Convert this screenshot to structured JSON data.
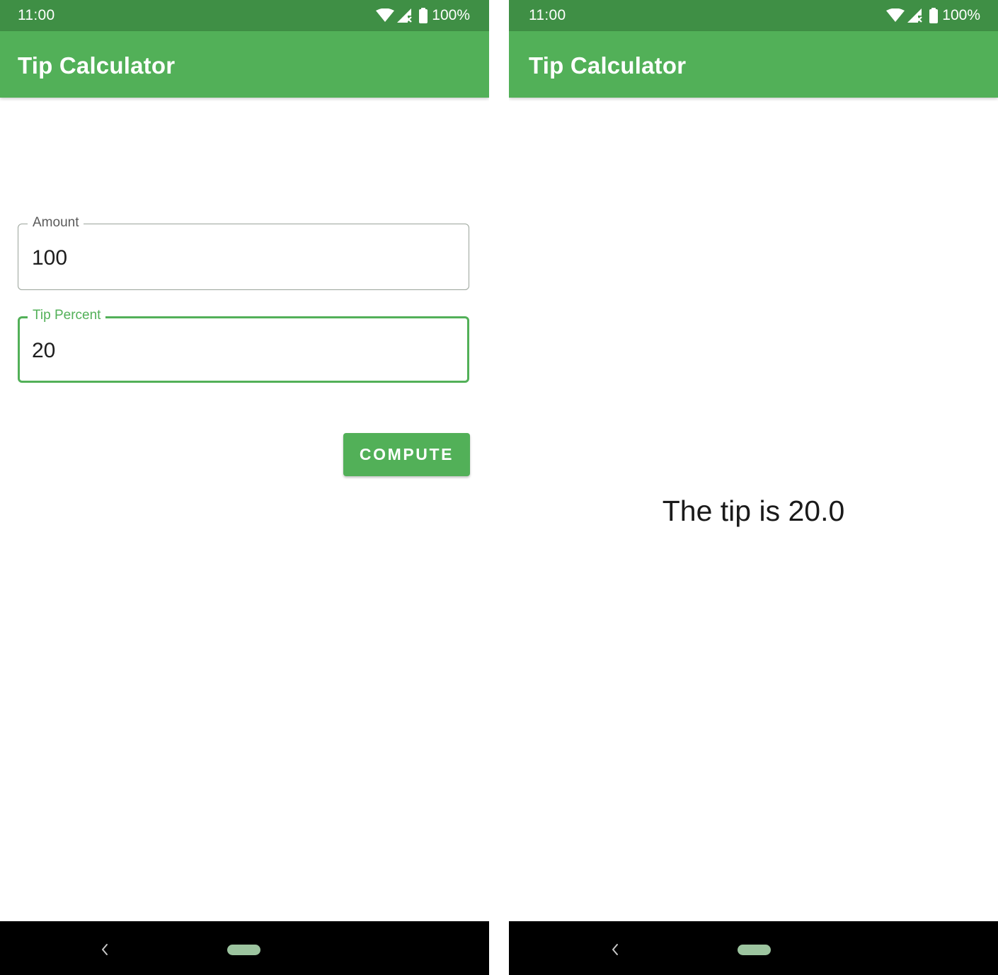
{
  "colors": {
    "status_bar": "#3f8f45",
    "app_bar": "#52b058",
    "accent": "#52b058",
    "nav_bar": "#000000"
  },
  "left_screen": {
    "status": {
      "time": "11:00",
      "battery": "100%",
      "icons": [
        "wifi-icon",
        "signal-icon",
        "battery-icon"
      ]
    },
    "app_bar": {
      "title": "Tip Calculator"
    },
    "amount_field": {
      "label": "Amount",
      "value": "100"
    },
    "tip_field": {
      "label": "Tip Percent",
      "value": "20"
    },
    "compute_button": {
      "label": "COMPUTE"
    },
    "nav": {
      "icons": [
        "back-icon",
        "home-icon"
      ]
    }
  },
  "right_screen": {
    "status": {
      "time": "11:00",
      "battery": "100%",
      "icons": [
        "wifi-icon",
        "signal-icon",
        "battery-icon"
      ]
    },
    "app_bar": {
      "title": "Tip Calculator"
    },
    "result": "The tip is 20.0",
    "nav": {
      "icons": [
        "back-icon",
        "home-icon"
      ]
    }
  }
}
